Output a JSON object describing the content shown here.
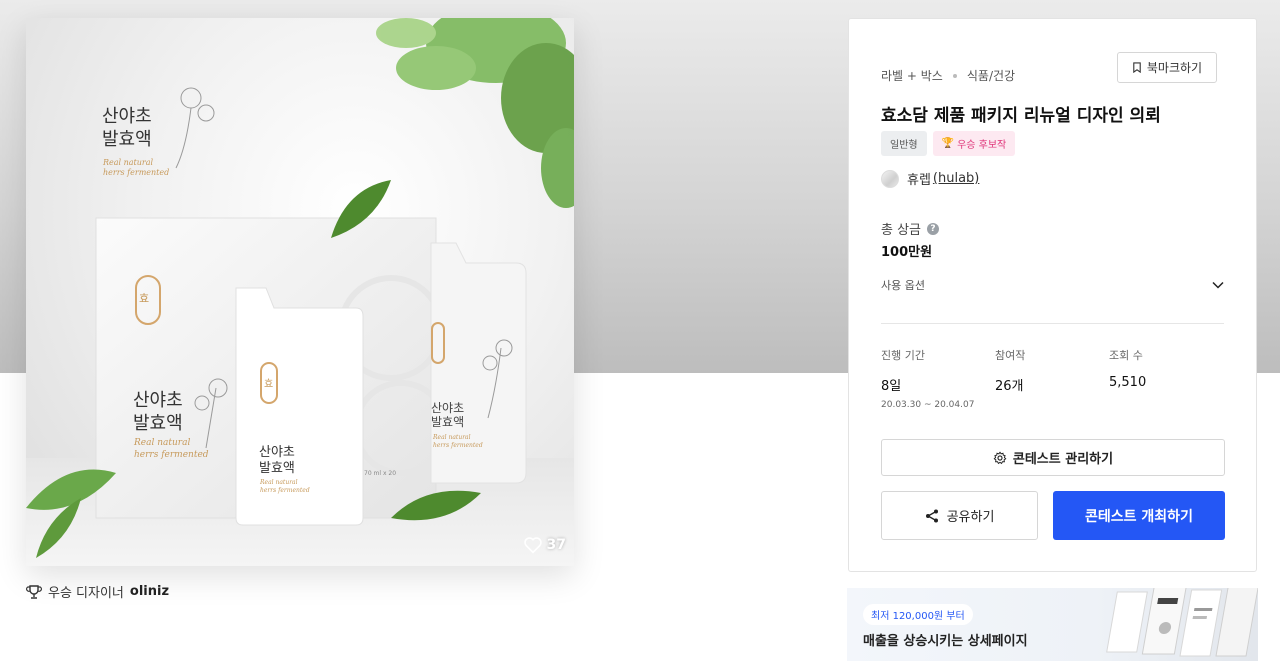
{
  "hero": {
    "pkg_title_1": "산야초",
    "pkg_title_2": "발효액",
    "pkg_sub_1": "Real natural",
    "pkg_sub_2": "herrs fermented",
    "seal_char": "효",
    "volume": "70 ml x 20",
    "likes": "37"
  },
  "winner": {
    "label": "우승 디자이너",
    "name": "oliniz"
  },
  "card": {
    "category": "라벨 + 박스",
    "subcategory": "식품/건강",
    "bookmark_label": "북마크하기",
    "title": "효소담 제품 패키지 리뉴얼 디자인 의뢰",
    "badge_type": "일반형",
    "badge_award": "우승 후보작",
    "author_name": "휴렙",
    "author_handle": "(hulab)",
    "prize_label": "총 상금",
    "prize_value": "100만원",
    "usage_label": "사용 옵션",
    "stats": {
      "period_label": "진행 기간",
      "period_value": "8일",
      "period_range": "20.03.30 ~ 20.04.07",
      "participants_label": "참여작",
      "participants_value": "26개",
      "views_label": "조회 수",
      "views_value": "5,510"
    },
    "manage_label": "콘테스트 관리하기",
    "share_label": "공유하기",
    "host_label": "콘테스트 개최하기"
  },
  "ad": {
    "pill": "최저 120,000원 부터",
    "title": "매출을 상승시키는 상세페이지"
  },
  "colors": {
    "primary": "#2457f5",
    "award": "#e0357a",
    "leaf": "#5e9a3c"
  }
}
